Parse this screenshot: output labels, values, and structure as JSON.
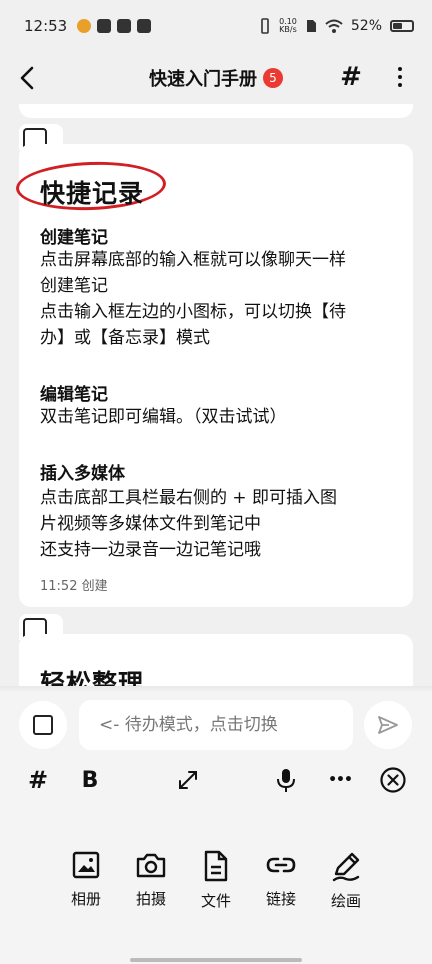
{
  "status_bar": {
    "time": "12:53",
    "net_speed_value": "0.10",
    "net_speed_unit": "KB/s",
    "battery": "52%",
    "battery_level": 0.52
  },
  "header": {
    "title": "快速入门手册",
    "badge": "5"
  },
  "note1": {
    "title": "快捷记录",
    "sections": [
      {
        "heading": "创建笔记",
        "lines": [
          "点击屏幕底部的输入框就可以像聊天一样",
          "创建笔记",
          "点击输入框左边的小图标，可以切换【待",
          "办】或【备忘录】模式"
        ]
      },
      {
        "heading": "编辑笔记",
        "lines": [
          "双击笔记即可编辑。（双击试试）"
        ]
      },
      {
        "heading": "插入多媒体",
        "lines": [
          "点击底部工具栏最右侧的 + 即可插入图",
          "片视频等多媒体文件到笔记中",
          "还支持一边录音一边记笔记哦"
        ]
      }
    ],
    "meta": "11:52 创建"
  },
  "note2": {
    "title": "轻松整理"
  },
  "composer": {
    "placeholder": "<- 待办模式，点击切换"
  },
  "toolbar": {
    "hash": "#",
    "bold": "B",
    "more": "•••"
  },
  "media": [
    {
      "label": "相册",
      "icon": "image-icon"
    },
    {
      "label": "拍摄",
      "icon": "camera-icon"
    },
    {
      "label": "文件",
      "icon": "file-icon"
    },
    {
      "label": "链接",
      "icon": "link-icon"
    },
    {
      "label": "绘画",
      "icon": "draw-icon"
    }
  ],
  "colors": {
    "accent_red": "#d11f24",
    "badge": "#ea3a32",
    "background": "#f0f0f0"
  }
}
